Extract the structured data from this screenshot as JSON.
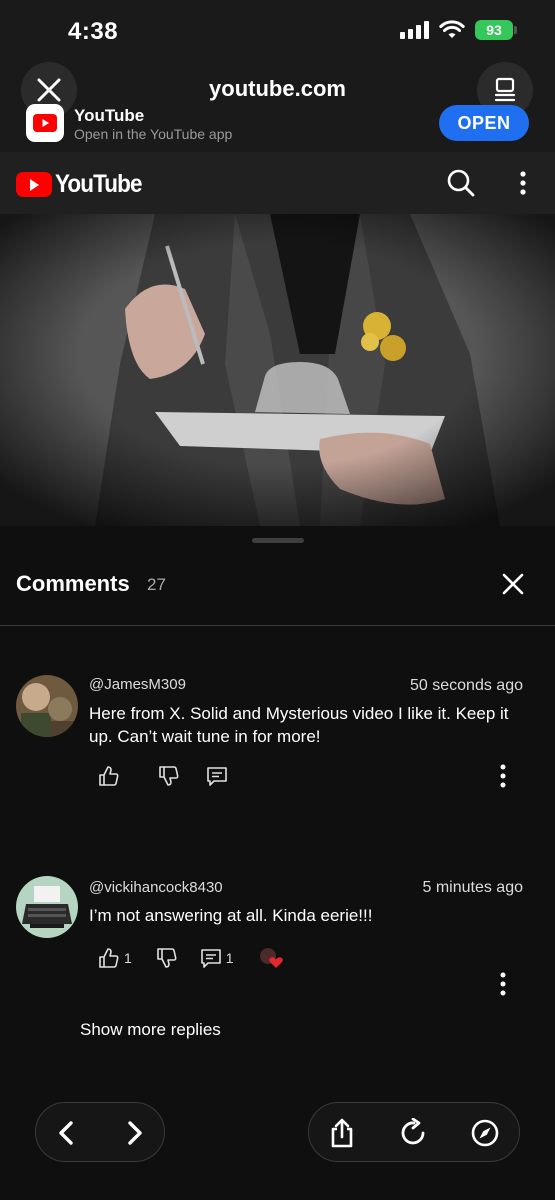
{
  "status_bar": {
    "time": "4:38",
    "battery": "93"
  },
  "browser": {
    "url": "youtube.com",
    "app_banner": {
      "title": "YouTube",
      "subtitle": "Open in the YouTube app",
      "open_label": "OPEN"
    }
  },
  "youtube_header": {
    "logo_text": "YouTube"
  },
  "comments": {
    "title": "Comments",
    "count": "27",
    "items": [
      {
        "author": "@JamesM309",
        "time": "50 seconds ago",
        "text": "Here from X. Solid and Mysterious video I like it. Keep it up. Can’t wait tune in for more!",
        "likes": "",
        "replies": ""
      },
      {
        "author": "@vickihancock8430",
        "time": "5 minutes ago",
        "text": "I’m not answering at all. Kinda eerie!!!",
        "likes": "1",
        "replies": "1"
      }
    ],
    "show_more_label": "Show more replies"
  },
  "icons": {
    "close": "close-icon",
    "tabs": "tabs-icon",
    "search": "search-icon",
    "more": "more-vert-icon",
    "like": "thumb-up-icon",
    "dislike": "thumb-down-icon",
    "reply": "reply-icon",
    "back": "chevron-left-icon",
    "forward": "chevron-right-icon",
    "share": "share-icon",
    "reload": "reload-icon",
    "compass": "compass-icon"
  },
  "colors": {
    "youtube_red": "#ff0000",
    "open_button": "#1f6ff0",
    "battery": "#34c759"
  }
}
